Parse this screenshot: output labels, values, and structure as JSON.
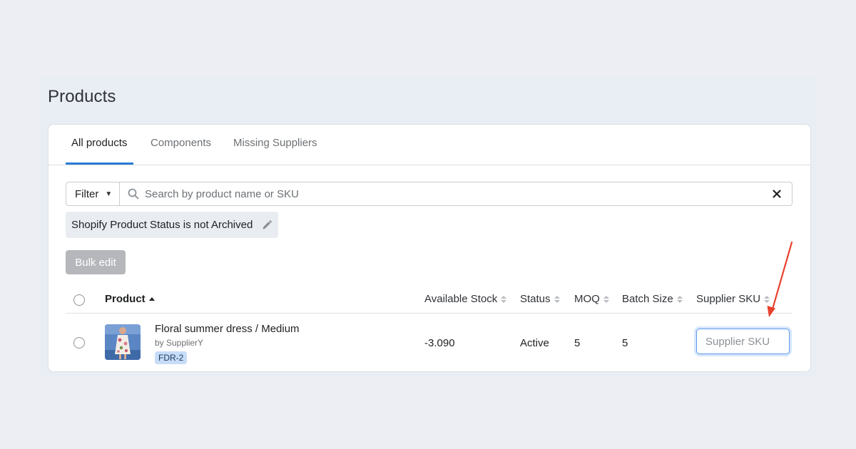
{
  "page": {
    "title": "Products"
  },
  "tabs": [
    {
      "label": "All products",
      "active": true
    },
    {
      "label": "Components",
      "active": false
    },
    {
      "label": "Missing Suppliers",
      "active": false
    }
  ],
  "filter": {
    "button_label": "Filter",
    "search_placeholder": "Search by product name or SKU",
    "search_value": ""
  },
  "active_filter_chip": {
    "label": "Shopify Product Status is not Archived"
  },
  "bulk_edit_label": "Bulk edit",
  "table": {
    "columns": [
      {
        "label": "Product",
        "sort": "asc"
      },
      {
        "label": "Available Stock",
        "sort": "none"
      },
      {
        "label": "Status",
        "sort": "none"
      },
      {
        "label": "MOQ",
        "sort": "none"
      },
      {
        "label": "Batch Size",
        "sort": "none"
      },
      {
        "label": "Supplier SKU",
        "sort": "none"
      }
    ],
    "rows": [
      {
        "name": "Floral summer dress / Medium",
        "supplier": "by SupplierY",
        "sku_badge": "FDR-2",
        "available_stock": "-3.090",
        "status": "Active",
        "moq": "5",
        "batch_size": "5",
        "supplier_sku_value": "",
        "supplier_sku_placeholder": "Supplier SKU"
      }
    ]
  },
  "colors": {
    "accent": "#2b7bd6",
    "annotation_arrow": "#e8412c",
    "badge_bg": "#c7dcf7",
    "disabled_button": "#b5b7ba"
  }
}
